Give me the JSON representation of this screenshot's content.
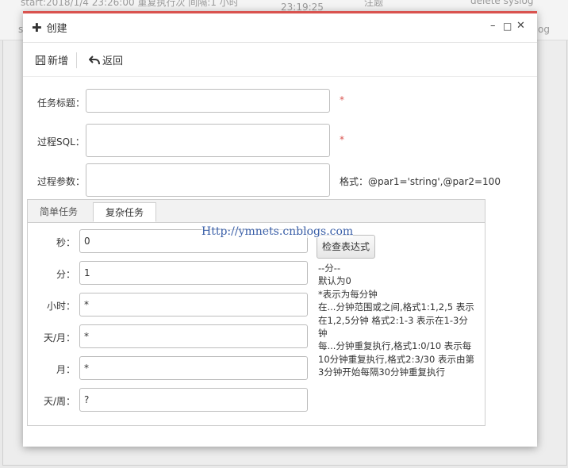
{
  "background": {
    "row1": {
      "col1": "start:2018/1/4 23:26:00 重复执行次 间隔:1 小时",
      "col2": "23:19:25",
      "col3": "注题",
      "col4": "delete  syslog"
    },
    "row2": {
      "col1": "s",
      "col4": "og"
    }
  },
  "modal": {
    "title": "创建",
    "title_icon": "plus-icon",
    "controls": {
      "minimize": "–",
      "maximize": "□",
      "close": "✕"
    }
  },
  "toolbar": {
    "add_label": "新增",
    "add_icon": "save-icon",
    "back_label": "返回",
    "back_icon": "undo-icon"
  },
  "form": {
    "task_title": {
      "label": "任务标题：",
      "value": "",
      "required": "*"
    },
    "proc_sql": {
      "label": "过程SQL：",
      "value": "",
      "required": "*"
    },
    "proc_params": {
      "label": "过程参数：",
      "value": "",
      "hint": "格式：@par1='string',@par2=100"
    }
  },
  "tabs": [
    {
      "label": "简单任务",
      "active": false
    },
    {
      "label": "复杂任务",
      "active": true
    }
  ],
  "cron": {
    "fields": [
      {
        "label": "秒：",
        "value": "0"
      },
      {
        "label": "分：",
        "value": "1"
      },
      {
        "label": "小时：",
        "value": "*"
      },
      {
        "label": "天/月：",
        "value": "*"
      },
      {
        "label": "月：",
        "value": "*"
      },
      {
        "label": "天/周：",
        "value": "?"
      }
    ],
    "check_button": "检查表达式",
    "help_lines": [
      "--分--",
      "默认为0",
      "*表示为每分钟",
      "在...分钟范围或之间,格式1:1,2,5 表示在1,2,5分钟 格式2:1-3 表示在1-3分钟",
      "每...分钟重复执行,格式1:0/10 表示每10分钟重复执行,格式2:3/30 表示由第3分钟开始每隔30分钟重复执行"
    ]
  },
  "watermark": "Http://ymnets.cnblogs.com",
  "colors": {
    "accent": "#d9534f",
    "watermark": "#3a5fa8"
  }
}
